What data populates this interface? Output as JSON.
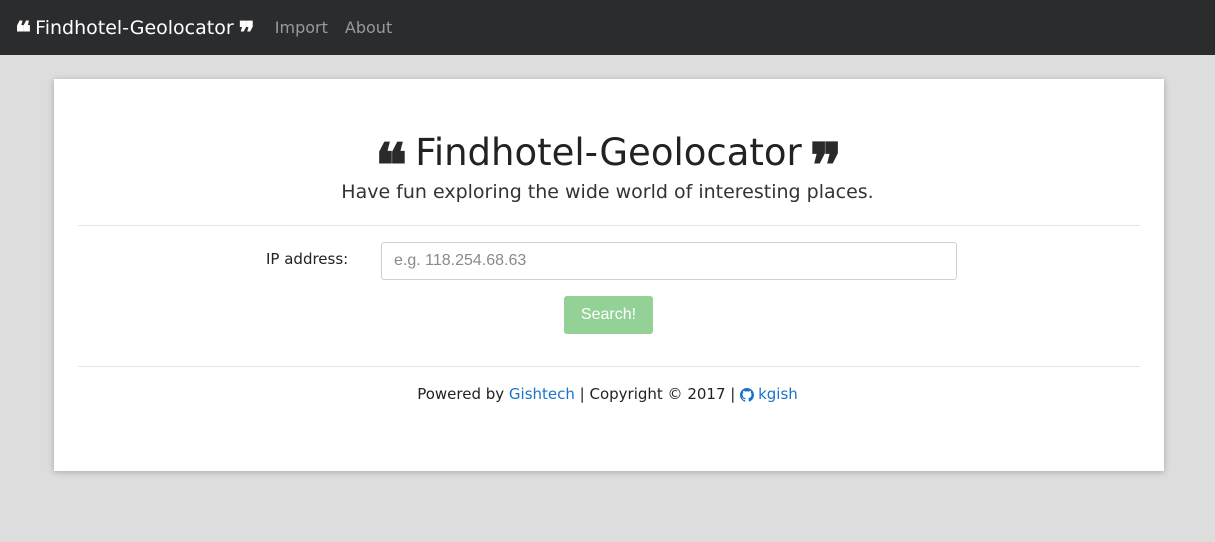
{
  "navbar": {
    "brand": {
      "open_quote": "❝",
      "title": "Findhotel-Geolocator",
      "close_quote": "❞"
    },
    "links": [
      {
        "label": "Import"
      },
      {
        "label": "About"
      }
    ],
    "background_color": "#2b2c2e"
  },
  "hero": {
    "open_quote": "❝",
    "title": "Findhotel-Geolocator",
    "close_quote": "❞",
    "subtitle": "Have fun exploring the wide world of interesting places."
  },
  "form": {
    "ip_label": "IP address:",
    "ip_value": "",
    "ip_placeholder": "e.g. 118.254.68.63",
    "search_label": "Search!",
    "search_color": "#93d196"
  },
  "footer": {
    "powered_by_prefix": "Powered by ",
    "powered_by_link": "Gishtech",
    "copyright": " | Copyright © 2017 | ",
    "github_icon": "github-icon",
    "github_user": "kgish",
    "link_color": "#1a73c9"
  },
  "colors": {
    "page_background": "#dddddd",
    "panel_background": "#ffffff"
  }
}
